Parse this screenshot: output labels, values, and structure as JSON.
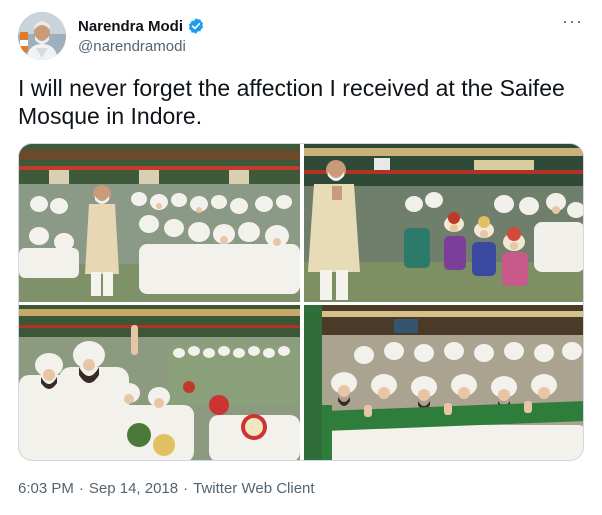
{
  "author": {
    "display_name": "Narendra Modi",
    "handle": "@narendramodi",
    "verified": true,
    "avatar_icon": "profile-photo"
  },
  "menu": {
    "more_icon": "more-horizontal-icon",
    "more_glyph": "···"
  },
  "tweet": {
    "text": "I will never forget the affection I received at the Saifee Mosque in Indore."
  },
  "media": {
    "count": 4,
    "photos": [
      "photo-1",
      "photo-2",
      "photo-3",
      "photo-4"
    ]
  },
  "meta": {
    "time": "6:03 PM",
    "separator": "·",
    "date": "Sep 14, 2018",
    "client": "Twitter Web Client"
  },
  "colors": {
    "text": "#0f1419",
    "secondary": "#536471",
    "verified_blue": "#1d9bf0",
    "border": "#cfd9de"
  }
}
